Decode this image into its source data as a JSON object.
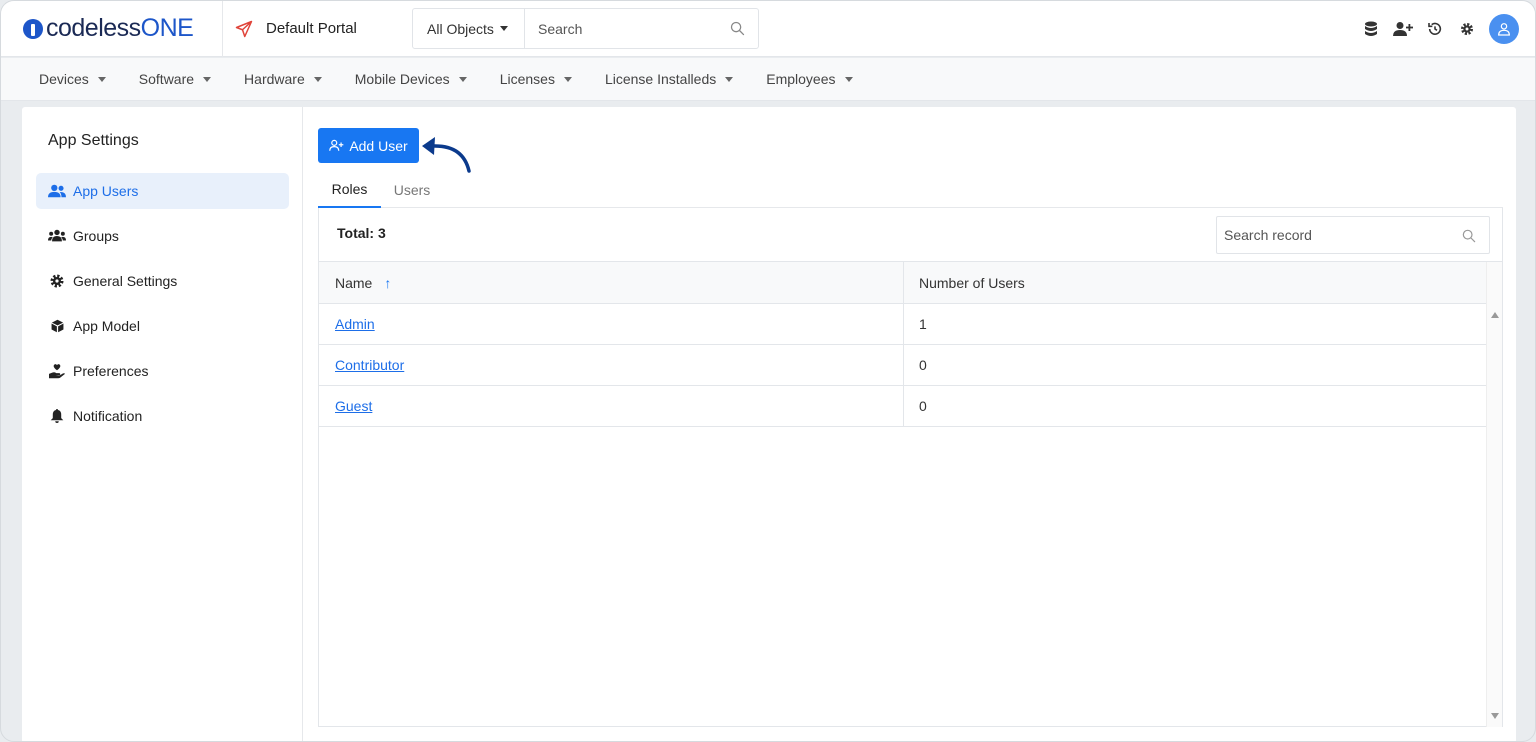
{
  "header": {
    "logo_prefix": "codeless",
    "logo_suffix": "ONE",
    "portal_icon": "paper-plane-icon",
    "portal_label": "Default Portal",
    "object_select": "All Objects",
    "search_placeholder": "Search",
    "icons": [
      "database-icon",
      "add-user-icon",
      "history-icon",
      "gear-icon",
      "user-avatar-icon"
    ]
  },
  "nav": {
    "items": [
      {
        "label": "Devices"
      },
      {
        "label": "Software"
      },
      {
        "label": "Hardware"
      },
      {
        "label": "Mobile Devices"
      },
      {
        "label": "Licenses"
      },
      {
        "label": "License Installeds"
      },
      {
        "label": "Employees"
      }
    ]
  },
  "sidebar": {
    "title": "App Settings",
    "items": [
      {
        "label": "App Users",
        "icon": "users-icon",
        "active": true
      },
      {
        "label": "Groups",
        "icon": "groups-icon"
      },
      {
        "label": "General Settings",
        "icon": "gear-icon"
      },
      {
        "label": "App Model",
        "icon": "cube-icon"
      },
      {
        "label": "Preferences",
        "icon": "hand-heart-icon"
      },
      {
        "label": "Notification",
        "icon": "bell-icon"
      }
    ]
  },
  "main": {
    "add_button": "Add User",
    "tabs": [
      {
        "label": "Roles",
        "active": true
      },
      {
        "label": "Users"
      }
    ],
    "total_label": "Total: 3",
    "record_search_placeholder": "Search record",
    "columns": [
      "Name",
      "Number of Users"
    ],
    "sort_indicator": "↑",
    "rows": [
      {
        "name": "Admin",
        "count": "1"
      },
      {
        "name": "Contributor",
        "count": "0"
      },
      {
        "name": "Guest",
        "count": "0"
      }
    ]
  },
  "colors": {
    "primary": "#1877f2",
    "link": "#1d6ee8",
    "logo_blue": "#1d56c9",
    "portal_icon": "#e0443a",
    "arrow": "#0b3a8c"
  }
}
